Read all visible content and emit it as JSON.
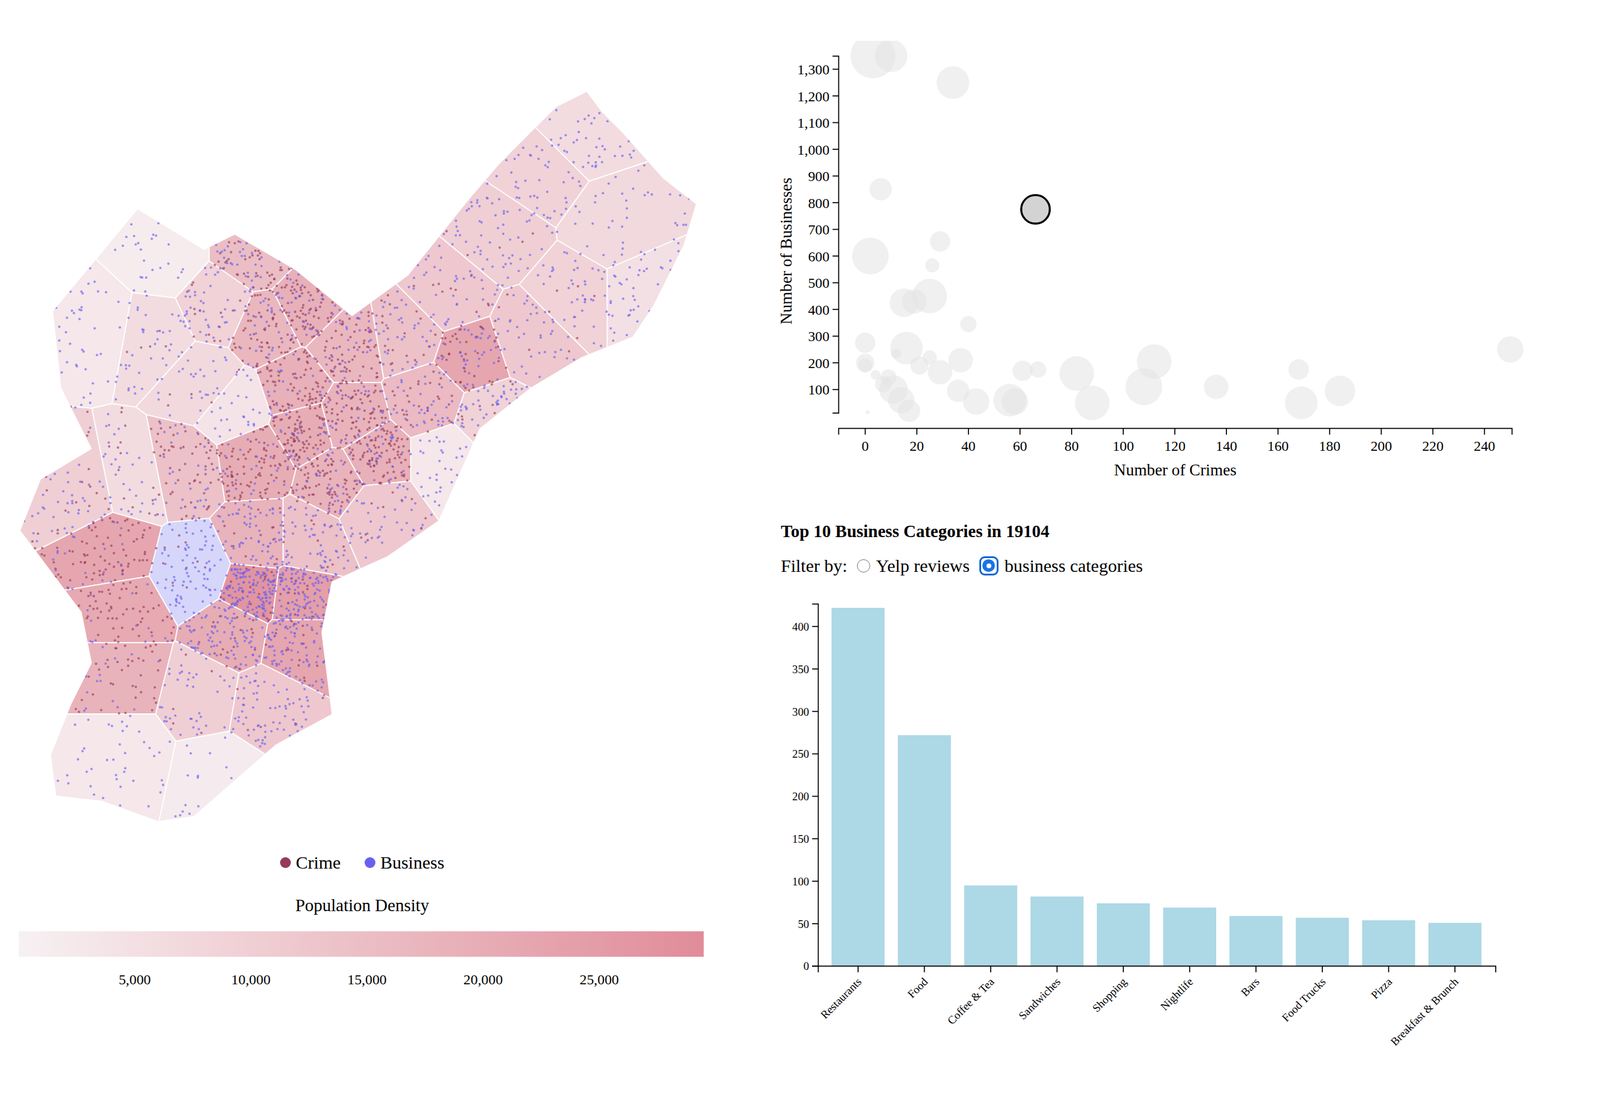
{
  "map": {
    "regions": [
      {
        "density": 3000,
        "crimes": 0,
        "businesses": 40,
        "selected": false
      },
      {
        "density": 1500,
        "crimes": 0,
        "businesses": 25,
        "selected": false
      },
      {
        "density": 6000,
        "crimes": 5,
        "businesses": 40,
        "selected": false
      },
      {
        "density": 9000,
        "crimes": 15,
        "businesses": 40,
        "selected": false
      },
      {
        "density": 7000,
        "crimes": 5,
        "businesses": 30,
        "selected": false
      },
      {
        "density": 15000,
        "crimes": 40,
        "businesses": 30,
        "selected": false
      },
      {
        "density": 17000,
        "crimes": 60,
        "businesses": 30,
        "selected": false
      },
      {
        "density": 19000,
        "crimes": 70,
        "businesses": 30,
        "selected": false
      },
      {
        "density": 17000,
        "crimes": 70,
        "businesses": 30,
        "selected": false
      },
      {
        "density": 4000,
        "crimes": 0,
        "businesses": 25,
        "selected": false
      },
      {
        "density": 19000,
        "crimes": 80,
        "businesses": 20,
        "selected": false
      },
      {
        "density": 20000,
        "crimes": 90,
        "businesses": 20,
        "selected": false
      },
      {
        "density": 20000,
        "crimes": 90,
        "businesses": 25,
        "selected": false
      },
      {
        "density": 18000,
        "crimes": 80,
        "businesses": 25,
        "selected": false
      },
      {
        "density": 19000,
        "crimes": 90,
        "businesses": 30,
        "selected": false
      },
      {
        "density": 18000,
        "crimes": 80,
        "businesses": 30,
        "selected": false
      },
      {
        "density": 14000,
        "crimes": 20,
        "businesses": 40,
        "selected": false
      },
      {
        "density": 12000,
        "crimes": 10,
        "businesses": 40,
        "selected": false
      },
      {
        "density": 22000,
        "crimes": 40,
        "businesses": 40,
        "selected": false
      },
      {
        "density": 16000,
        "crimes": 30,
        "businesses": 40,
        "selected": false
      },
      {
        "density": 10000,
        "crimes": 5,
        "businesses": 60,
        "selected": false
      },
      {
        "density": 9000,
        "crimes": 0,
        "businesses": 40,
        "selected": false
      },
      {
        "density": 6000,
        "crimes": 0,
        "businesses": 40,
        "selected": false
      },
      {
        "density": 7000,
        "crimes": 0,
        "businesses": 40,
        "selected": false
      },
      {
        "density": 5000,
        "crimes": 0,
        "businesses": 40,
        "selected": false
      },
      {
        "density": 9000,
        "crimes": 5,
        "businesses": 40,
        "selected": false
      },
      {
        "density": 12000,
        "crimes": 5,
        "businesses": 40,
        "selected": false
      },
      {
        "density": 9000,
        "crimes": 10,
        "businesses": 40,
        "selected": false
      },
      {
        "density": 3000,
        "crimes": 0,
        "businesses": 30,
        "selected": false
      },
      {
        "density": 10000,
        "crimes": 20,
        "businesses": 40,
        "selected": false
      },
      {
        "density": 6000,
        "crimes": 15,
        "businesses": 30,
        "selected": false
      },
      {
        "density": 14000,
        "crimes": 60,
        "businesses": 30,
        "selected": false
      },
      {
        "density": 22000,
        "crimes": 80,
        "businesses": 20,
        "selected": false
      },
      {
        "density": 21000,
        "crimes": 60,
        "businesses": 15,
        "selected": false
      },
      {
        "density": 18000,
        "crimes": 40,
        "businesses": 15,
        "selected": false
      },
      {
        "density": 12000,
        "crimes": 10,
        "businesses": 80,
        "selected": true
      },
      {
        "density": 27000,
        "crimes": 20,
        "businesses": 150,
        "selected": false
      },
      {
        "density": 24000,
        "crimes": 15,
        "businesses": 120,
        "selected": false
      },
      {
        "density": 18000,
        "crimes": 15,
        "businesses": 70,
        "selected": false
      },
      {
        "density": 14000,
        "crimes": 10,
        "businesses": 60,
        "selected": false
      },
      {
        "density": 20000,
        "crimes": 20,
        "businesses": 100,
        "selected": false
      },
      {
        "density": 22000,
        "crimes": 15,
        "businesses": 90,
        "selected": false
      },
      {
        "density": 10000,
        "crimes": 5,
        "businesses": 40,
        "selected": false
      },
      {
        "density": 12000,
        "crimes": 5,
        "businesses": 70,
        "selected": false
      },
      {
        "density": 3000,
        "crimes": 0,
        "businesses": 40,
        "selected": false
      },
      {
        "density": 2000,
        "crimes": 0,
        "businesses": 15,
        "selected": false
      },
      {
        "density": 12000,
        "crimes": 10,
        "businesses": 40,
        "selected": false
      }
    ]
  },
  "legend": [
    {
      "label": "Crime",
      "kind": "crime",
      "color": "#953a5c"
    },
    {
      "label": "Business",
      "kind": "business",
      "color": "#6a60ef"
    }
  ],
  "density_legend": {
    "title": "Population Density",
    "max": 29500,
    "ticks": [
      {
        "label": "5,000",
        "value": 5000
      },
      {
        "label": "10,000",
        "value": 10000
      },
      {
        "label": "15,000",
        "value": 15000
      },
      {
        "label": "20,000",
        "value": 20000
      },
      {
        "label": "25,000",
        "value": 25000
      }
    ]
  },
  "scatter": {
    "x_axis": {
      "title": "Number of Crimes",
      "ticks": [
        {
          "label": "0",
          "value": 0
        },
        {
          "label": "20",
          "value": 20
        },
        {
          "label": "40",
          "value": 40
        },
        {
          "label": "60",
          "value": 60
        },
        {
          "label": "80",
          "value": 80
        },
        {
          "label": "100",
          "value": 100
        },
        {
          "label": "120",
          "value": 120
        },
        {
          "label": "140",
          "value": 140
        },
        {
          "label": "160",
          "value": 160
        },
        {
          "label": "180",
          "value": 180
        },
        {
          "label": "200",
          "value": 200
        },
        {
          "label": "220",
          "value": 220
        },
        {
          "label": "240",
          "value": 240
        }
      ]
    },
    "y_axis": {
      "title": "Number of Businesses",
      "ticks": [
        {
          "label": "100",
          "value": 100
        },
        {
          "label": "200",
          "value": 200
        },
        {
          "label": "300",
          "value": 300
        },
        {
          "label": "400",
          "value": 400
        },
        {
          "label": "500",
          "value": 500
        },
        {
          "label": "600",
          "value": 600
        },
        {
          "label": "700",
          "value": 700
        },
        {
          "label": "800",
          "value": 800
        },
        {
          "label": "900",
          "value": 900
        },
        {
          "label": "1,000",
          "value": 1000
        },
        {
          "label": "1,100",
          "value": 1100
        },
        {
          "label": "1,200",
          "value": 1200
        },
        {
          "label": "1,300",
          "value": 1300
        }
      ]
    },
    "points": [
      {
        "crimes": 3,
        "businesses": 1350,
        "population": 121,
        "selected": false
      },
      {
        "crimes": 10,
        "businesses": 1350,
        "population": 64,
        "selected": false
      },
      {
        "crimes": 34,
        "businesses": 1250,
        "population": 64,
        "selected": false
      },
      {
        "crimes": 6,
        "businesses": 850,
        "population": 30,
        "selected": false
      },
      {
        "crimes": 29,
        "businesses": 655,
        "population": 25,
        "selected": false
      },
      {
        "crimes": 26,
        "businesses": 565,
        "population": 12,
        "selected": false
      },
      {
        "crimes": 2,
        "businesses": 600,
        "population": 81,
        "selected": false
      },
      {
        "crimes": 15,
        "businesses": 425,
        "population": 49,
        "selected": false
      },
      {
        "crimes": 19,
        "businesses": 430,
        "population": 36,
        "selected": false
      },
      {
        "crimes": 25,
        "businesses": 450,
        "population": 72,
        "selected": false
      },
      {
        "crimes": 40,
        "businesses": 345,
        "population": 16,
        "selected": false
      },
      {
        "crimes": 0,
        "businesses": 275,
        "population": 25,
        "selected": false
      },
      {
        "crimes": 0,
        "businesses": 200,
        "population": 20,
        "selected": false
      },
      {
        "crimes": 0,
        "businesses": 190,
        "population": 12,
        "selected": false
      },
      {
        "crimes": 4,
        "businesses": 155,
        "population": 6,
        "selected": false
      },
      {
        "crimes": 7,
        "businesses": 120,
        "population": 16,
        "selected": false
      },
      {
        "crimes": 16,
        "businesses": 255,
        "population": 64,
        "selected": false
      },
      {
        "crimes": 12,
        "businesses": 235,
        "population": 6,
        "selected": false
      },
      {
        "crimes": 9,
        "businesses": 145,
        "population": 16,
        "selected": false
      },
      {
        "crimes": 11,
        "businesses": 100,
        "population": 49,
        "selected": false
      },
      {
        "crimes": 14,
        "businesses": 60,
        "population": 42,
        "selected": false
      },
      {
        "crimes": 17,
        "businesses": 20,
        "population": 30,
        "selected": false
      },
      {
        "crimes": 21,
        "businesses": 190,
        "population": 20,
        "selected": false
      },
      {
        "crimes": 25,
        "businesses": 220,
        "population": 12,
        "selected": false
      },
      {
        "crimes": 29,
        "businesses": 165,
        "population": 36,
        "selected": false
      },
      {
        "crimes": 37,
        "businesses": 210,
        "population": 36,
        "selected": false
      },
      {
        "crimes": 36,
        "businesses": 95,
        "population": 30,
        "selected": false
      },
      {
        "crimes": 43,
        "businesses": 55,
        "population": 42,
        "selected": false
      },
      {
        "crimes": 56,
        "businesses": 60,
        "population": 64,
        "selected": false
      },
      {
        "crimes": 58,
        "businesses": 55,
        "population": 42,
        "selected": false
      },
      {
        "crimes": 61,
        "businesses": 170,
        "population": 25,
        "selected": false
      },
      {
        "crimes": 67,
        "businesses": 175,
        "population": 16,
        "selected": false
      },
      {
        "crimes": 82,
        "businesses": 160,
        "population": 72,
        "selected": false
      },
      {
        "crimes": 88,
        "businesses": 50,
        "population": 72,
        "selected": false
      },
      {
        "crimes": 108,
        "businesses": 110,
        "population": 81,
        "selected": false
      },
      {
        "crimes": 112,
        "businesses": 205,
        "population": 72,
        "selected": false
      },
      {
        "crimes": 136,
        "businesses": 110,
        "population": 36,
        "selected": false
      },
      {
        "crimes": 168,
        "businesses": 175,
        "population": 25,
        "selected": false
      },
      {
        "crimes": 169,
        "businesses": 50,
        "population": 64,
        "selected": false
      },
      {
        "crimes": 184,
        "businesses": 95,
        "population": 56,
        "selected": false
      },
      {
        "crimes": 250,
        "businesses": 250,
        "population": 42,
        "selected": false
      },
      {
        "crimes": 1,
        "businesses": 15,
        "population": 1,
        "selected": false
      },
      {
        "crimes": 66,
        "businesses": 775,
        "population": 49,
        "selected": true
      }
    ]
  },
  "categories": {
    "title": "Top 10 Business Categories in 19104",
    "filter": {
      "label": "Filter by:",
      "options": [
        {
          "label": "Yelp reviews",
          "selected": false
        },
        {
          "label": "business categories",
          "selected": true
        }
      ]
    },
    "y_axis": {
      "ticks": [
        {
          "label": "0",
          "value": 0
        },
        {
          "label": "50",
          "value": 50
        },
        {
          "label": "100",
          "value": 100
        },
        {
          "label": "150",
          "value": 150
        },
        {
          "label": "200",
          "value": 200
        },
        {
          "label": "250",
          "value": 250
        },
        {
          "label": "300",
          "value": 300
        },
        {
          "label": "350",
          "value": 350
        },
        {
          "label": "400",
          "value": 400
        }
      ]
    },
    "bars": [
      {
        "label": "Restaurants",
        "value": 422
      },
      {
        "label": "Food",
        "value": 272
      },
      {
        "label": "Coffee & Tea",
        "value": 95
      },
      {
        "label": "Sandwiches",
        "value": 82
      },
      {
        "label": "Shopping",
        "value": 74
      },
      {
        "label": "Nightlife",
        "value": 69
      },
      {
        "label": "Bars",
        "value": 59
      },
      {
        "label": "Food Trucks",
        "value": 57
      },
      {
        "label": "Pizza",
        "value": 54
      },
      {
        "label": "Breakfast & Brunch",
        "value": 51
      }
    ]
  }
}
